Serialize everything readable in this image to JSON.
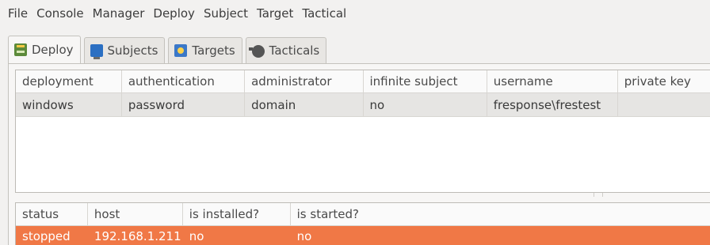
{
  "menubar": {
    "items": [
      "File",
      "Console",
      "Manager",
      "Deploy",
      "Subject",
      "Target",
      "Tactical"
    ]
  },
  "tabs": [
    {
      "label": "Deploy",
      "icon": "deploy-icon",
      "active": true
    },
    {
      "label": "Subjects",
      "icon": "monitor-icon",
      "active": false
    },
    {
      "label": "Targets",
      "icon": "target-icon",
      "active": false
    },
    {
      "label": "Tacticals",
      "icon": "tactical-icon",
      "active": false
    }
  ],
  "deploy_table": {
    "columns": [
      "deployment",
      "authentication",
      "administrator",
      "infinite subject",
      "username",
      "private key"
    ],
    "rows": [
      [
        "windows",
        "password",
        "domain",
        "no",
        "fresponse\\frestest",
        ""
      ]
    ]
  },
  "status_table": {
    "columns": [
      "status",
      "host",
      "is installed?",
      "is started?"
    ],
    "rows": [
      [
        "stopped",
        "192.168.1.211",
        "no",
        "no"
      ]
    ],
    "highlight_color": "#f07846"
  }
}
